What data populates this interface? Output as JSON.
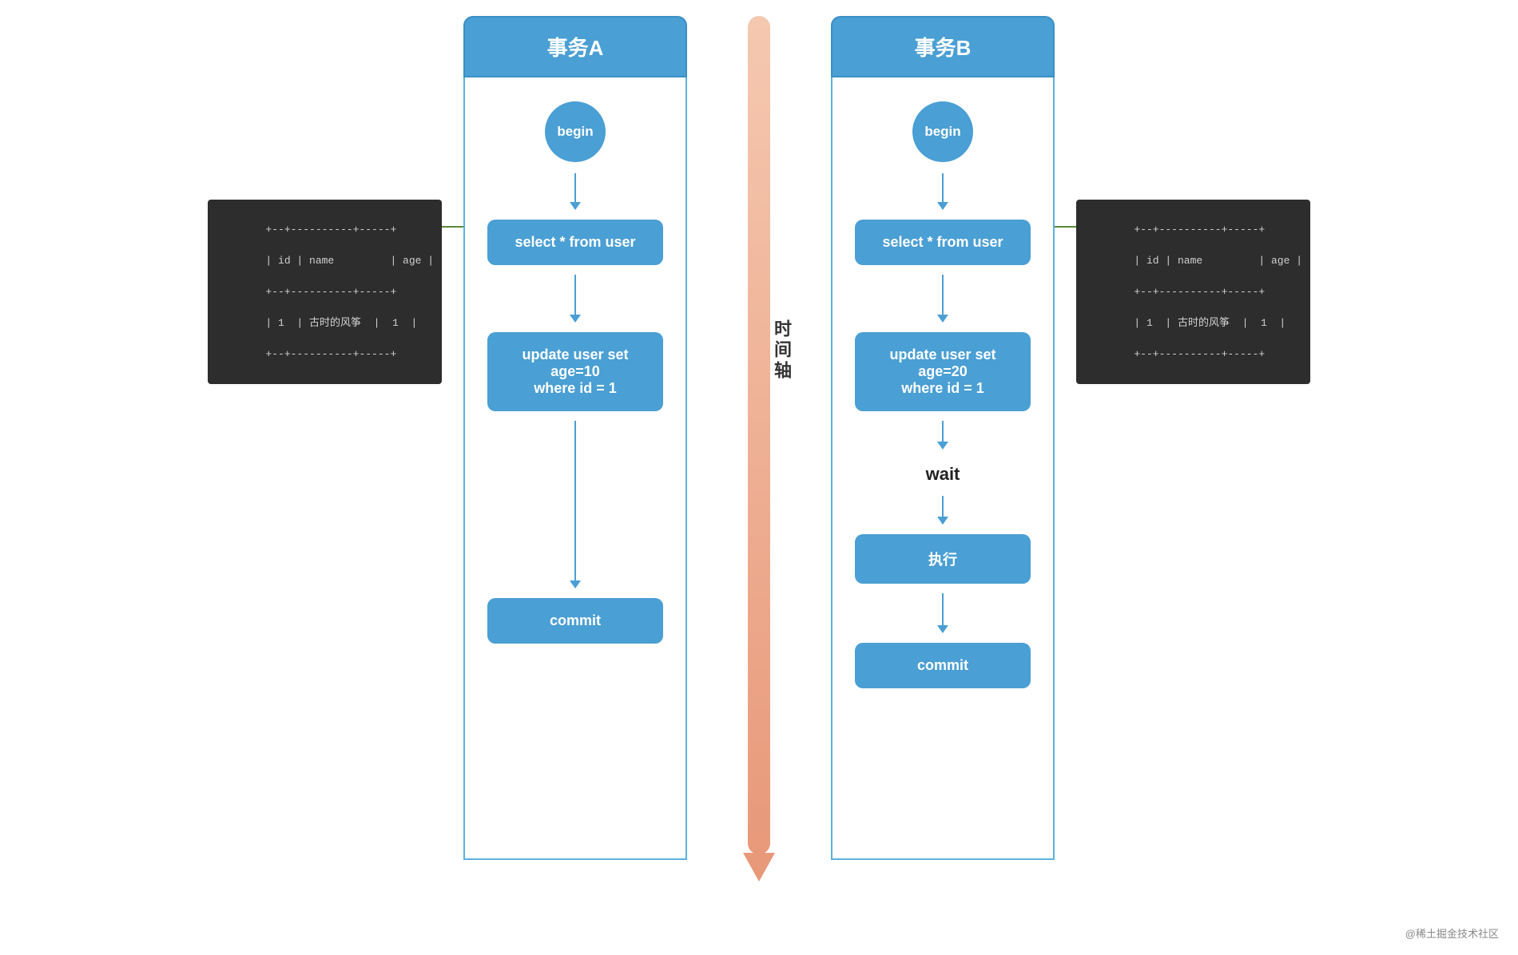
{
  "page": {
    "background": "#ffffff",
    "copyright": "@稀土掘金技术社区"
  },
  "time_axis": {
    "label": "时间轴"
  },
  "transaction_a": {
    "title": "事务A",
    "begin": "begin",
    "select_node": "select * from user",
    "update_node_line1": "update user set age=10",
    "update_node_line2": "where id = 1",
    "commit": "commit",
    "table": {
      "line1": "+--+----------+-----+",
      "line2": "| id | name         | age |",
      "line3": "+--+----------+-----+",
      "line4": "| 1  | 古时的风筝  |  1  |",
      "line5": "+--+----------+-----+"
    }
  },
  "transaction_b": {
    "title": "事务B",
    "begin": "begin",
    "select_node": "select * from user",
    "update_node_line1": "update user set age=20",
    "update_node_line2": "where id = 1",
    "wait": "wait",
    "execute": "执行",
    "commit": "commit",
    "table": {
      "line1": "+--+----------+-----+",
      "line2": "| id | name         | age |",
      "line3": "+--+----------+-----+",
      "line4": "| 1  | 古时的风筝  |  1  |",
      "line5": "+--+----------+-----+"
    }
  }
}
